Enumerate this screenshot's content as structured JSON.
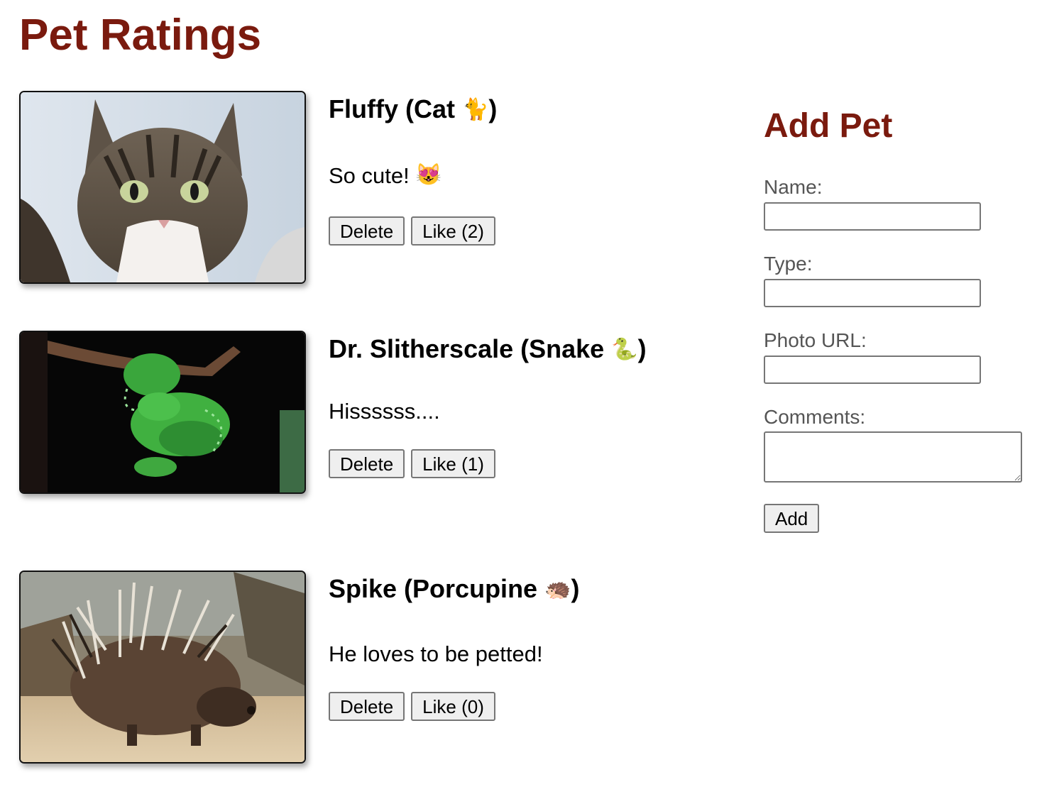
{
  "page": {
    "title": "Pet Ratings"
  },
  "pets": [
    {
      "name": "Fluffy",
      "type": "Cat",
      "type_emoji": "🐈",
      "comment": "So cute!",
      "comment_emoji": "😻",
      "delete_label": "Delete",
      "like_label": "Like",
      "likes": "2"
    },
    {
      "name": "Dr. Slitherscale",
      "type": "Snake",
      "type_emoji": "🐍",
      "comment": "Hissssss....",
      "comment_emoji": "",
      "delete_label": "Delete",
      "like_label": "Like",
      "likes": "1"
    },
    {
      "name": "Spike",
      "type": "Porcupine",
      "type_emoji": "🦔",
      "comment": "He loves to be petted!",
      "comment_emoji": "",
      "delete_label": "Delete",
      "like_label": "Like",
      "likes": "0"
    }
  ],
  "form": {
    "title": "Add Pet",
    "name_label": "Name:",
    "name_value": "",
    "type_label": "Type:",
    "type_value": "",
    "photo_label": "Photo URL:",
    "photo_value": "",
    "comments_label": "Comments:",
    "comments_value": "",
    "submit_label": "Add"
  },
  "colors": {
    "heading": "#7a1a0e",
    "button_bg": "#efefef",
    "border": "#767676"
  }
}
